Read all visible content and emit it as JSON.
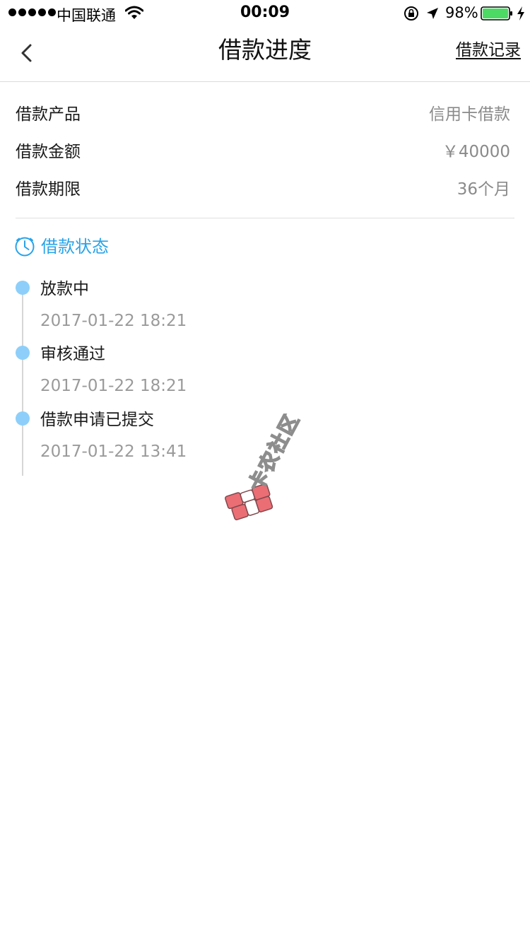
{
  "status_bar": {
    "carrier": "中国联通",
    "time": "00:09",
    "battery": "98%"
  },
  "nav": {
    "title": "借款进度",
    "right_link": "借款记录"
  },
  "info": [
    {
      "label": "借款产品",
      "value": "信用卡借款"
    },
    {
      "label": "借款金额",
      "value": "￥40000"
    },
    {
      "label": "借款期限",
      "value": "36个月"
    }
  ],
  "status_section": {
    "title": "借款状态",
    "steps": [
      {
        "title": "放款中",
        "time": "2017-01-22 18:21"
      },
      {
        "title": "审核通过",
        "time": "2017-01-22 18:21"
      },
      {
        "title": "借款申请已提交",
        "time": "2017-01-22 13:41"
      }
    ]
  },
  "watermark": {
    "text": "卡农社区"
  },
  "colors": {
    "accent": "#29a3e8",
    "timeline_dot": "#8dcffa",
    "battery": "#4cd964",
    "watermark": "#e8555e"
  }
}
